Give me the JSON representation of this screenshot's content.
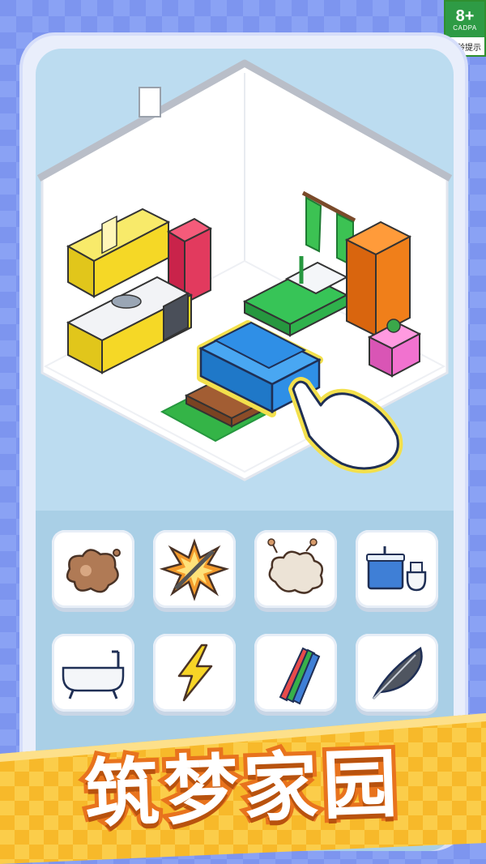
{
  "age_rating": {
    "age": "8+",
    "org": "CADPA",
    "tip": "适龄提示"
  },
  "game_title": "筑梦家园",
  "tools": [
    {
      "icon": "stain-icon"
    },
    {
      "icon": "crack-icon"
    },
    {
      "icon": "dust-cloud-icon"
    },
    {
      "icon": "bathroom-sink-toilet-icon"
    },
    {
      "icon": "bathtub-icon"
    },
    {
      "icon": "lightning-icon"
    },
    {
      "icon": "pencils-icon"
    },
    {
      "icon": "feather-icon"
    }
  ],
  "colors": {
    "background": "#7d95ef",
    "screen": "#bcdcf0",
    "title_fill": "#ffffff",
    "title_stroke": "#e8731d",
    "ribbon": "#f7b92a",
    "sofa": "#2f8fe6",
    "bed_green": "#37c457",
    "kitchen_yellow": "#f5d826",
    "wardrobe_orange": "#f07f1a"
  }
}
